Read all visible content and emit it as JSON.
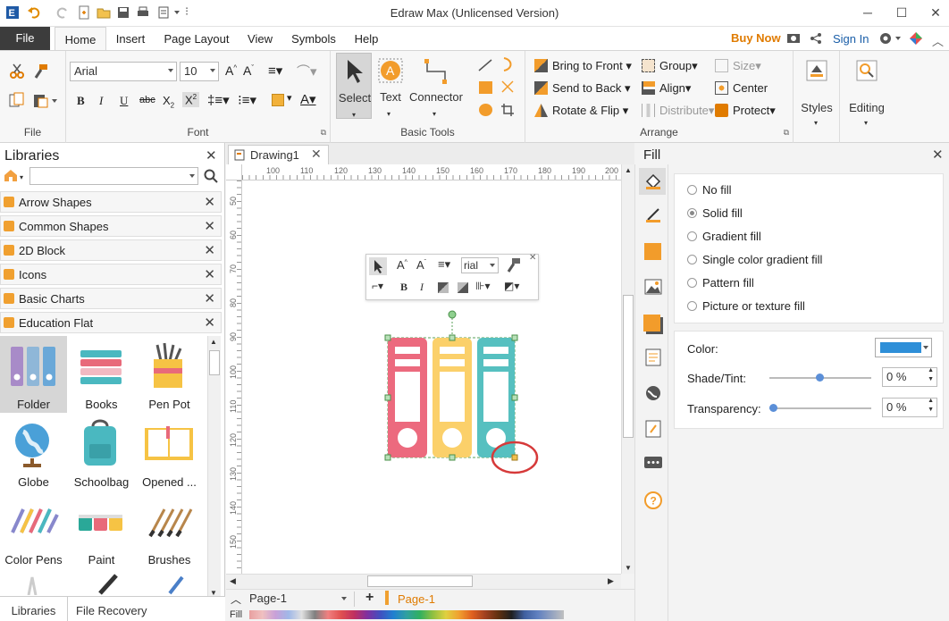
{
  "window": {
    "title": "Edraw Max (Unlicensed Version)"
  },
  "menu": {
    "file": "File",
    "tabs": [
      "Home",
      "Insert",
      "Page Layout",
      "View",
      "Symbols",
      "Help"
    ],
    "buy_now": "Buy Now",
    "sign_in": "Sign In"
  },
  "ribbon": {
    "file_group_label": "File",
    "font_group_label": "Font",
    "font_name": "Arial",
    "font_size": "10",
    "basic_tools_label": "Basic Tools",
    "select": "Select",
    "text": "Text",
    "connector": "Connector",
    "arrange_label": "Arrange",
    "bring_to_front": "Bring to Front",
    "send_to_back": "Send to Back",
    "rotate_flip": "Rotate & Flip",
    "group": "Group",
    "align": "Align",
    "distribute": "Distribute",
    "size": "Size",
    "center": "Center",
    "protect": "Protect",
    "styles": "Styles",
    "editing": "Editing"
  },
  "libraries": {
    "title": "Libraries",
    "categories": [
      "Arrow Shapes",
      "Common Shapes",
      "2D Block",
      "Icons",
      "Basic Charts",
      "Education Flat"
    ],
    "shapes": [
      "Folder",
      "Books",
      "Pen Pot",
      "Globe",
      "Schoolbag",
      "Opened ...",
      "Color Pens",
      "Paint",
      "Brushes"
    ],
    "bottom_tabs": [
      "Libraries",
      "File Recovery"
    ]
  },
  "document": {
    "tab_name": "Drawing1",
    "ruler_h": [
      "100",
      "110",
      "120",
      "130",
      "140",
      "150",
      "160",
      "170",
      "180",
      "190",
      "200"
    ],
    "ruler_v": [
      "50",
      "60",
      "70",
      "80",
      "90",
      "100",
      "110",
      "120",
      "130",
      "140",
      "150"
    ],
    "page_select": "Page-1",
    "page_tab": "Page-1",
    "fill_label": "Fill"
  },
  "mini_toolbar": {
    "font": "rial"
  },
  "fill_panel": {
    "title": "Fill",
    "options": [
      "No fill",
      "Solid fill",
      "Gradient fill",
      "Single color gradient fill",
      "Pattern fill",
      "Picture or texture fill"
    ],
    "selected_option": "Solid fill",
    "color_label": "Color:",
    "color_value": "#2e8fd8",
    "shade_label": "Shade/Tint:",
    "shade_value": "0 %",
    "transparency_label": "Transparency:",
    "transparency_value": "0 %"
  },
  "colors": {
    "accent_orange": "#e07b00",
    "binder_pink": "#ec6a7e",
    "binder_yellow": "#fbd06a",
    "binder_teal": "#56c0c0",
    "annotation_red": "#d63a3a"
  },
  "icons": [
    "app-logo-icon",
    "undo-icon",
    "redo-icon",
    "new-icon",
    "open-icon",
    "save-icon",
    "print-icon",
    "export-icon",
    "share-icon",
    "gear-icon",
    "close-icon",
    "search-icon",
    "home-icon"
  ]
}
